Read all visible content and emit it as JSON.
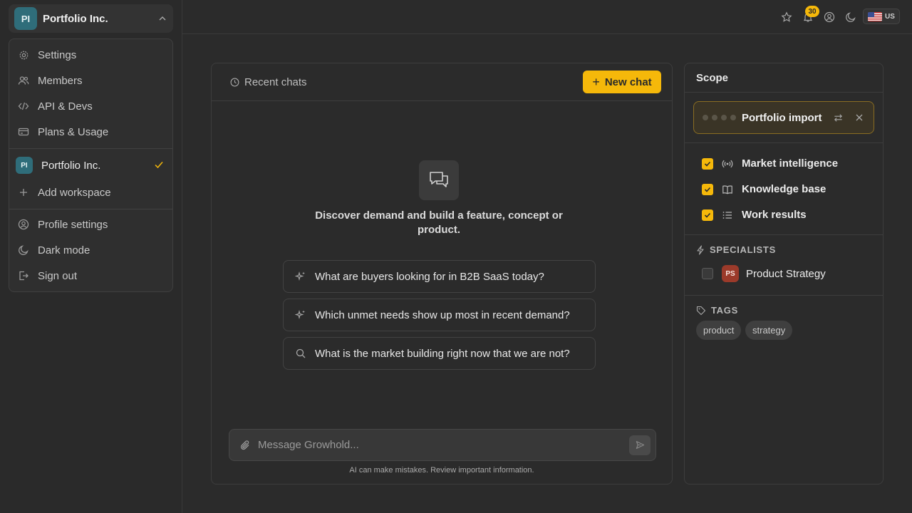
{
  "workspace": {
    "initials": "PI",
    "name": "Portfolio Inc."
  },
  "menu": {
    "items": [
      {
        "label": "Settings",
        "icon": "gear-icon"
      },
      {
        "label": "Members",
        "icon": "users-icon"
      },
      {
        "label": "API & Devs",
        "icon": "code-icon"
      },
      {
        "label": "Plans & Usage",
        "icon": "credit-card-icon"
      }
    ],
    "current_workspace": {
      "initials": "PI",
      "name": "Portfolio Inc.",
      "selected": true
    },
    "add_workspace": "Add workspace",
    "profile_settings": "Profile settings",
    "dark_mode": "Dark mode",
    "sign_out": "Sign out"
  },
  "topbar": {
    "notification_count": "30",
    "language": "US"
  },
  "chat": {
    "recent_label": "Recent chats",
    "new_chat_label": "New chat",
    "intro": "Discover demand and build a feature, concept or product.",
    "suggestions": [
      {
        "text": "What are buyers looking for in B2B SaaS today?",
        "icon": "sparkle-icon"
      },
      {
        "text": "Which unmet needs show up most in recent demand?",
        "icon": "sparkle-icon"
      },
      {
        "text": "What is the market building right now that we are not?",
        "icon": "search-icon"
      }
    ],
    "message_placeholder": "Message Growhold...",
    "disclaimer": "AI can make mistakes. Review important information."
  },
  "scope": {
    "title": "Scope",
    "import_label": "Portfolio import",
    "sources": [
      {
        "label": "Market intelligence",
        "checked": true,
        "icon": "broadcast-icon"
      },
      {
        "label": "Knowledge base",
        "checked": true,
        "icon": "book-icon"
      },
      {
        "label": "Work results",
        "checked": true,
        "icon": "list-icon"
      }
    ],
    "specialists_heading": "SPECIALISTS",
    "specialists": [
      {
        "initials": "PS",
        "name": "Product Strategy",
        "checked": false
      }
    ],
    "tags_heading": "TAGS",
    "tags": [
      "product",
      "strategy"
    ]
  },
  "colors": {
    "accent": "#f5b80a",
    "background": "#2b2b2b",
    "workspace_avatar": "#2f6d7a",
    "specialist_avatar": "#9b3a2a"
  }
}
